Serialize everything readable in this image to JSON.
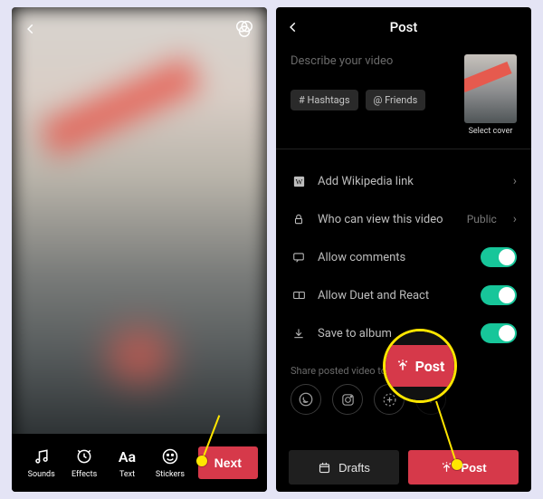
{
  "editor": {
    "tools": {
      "sounds": "Sounds",
      "effects": "Effects",
      "text": "Text",
      "stickers": "Stickers"
    },
    "next_label": "Next"
  },
  "post": {
    "title": "Post",
    "description_placeholder": "Describe your video",
    "chips": {
      "hashtags": "# Hashtags",
      "friends": "@ Friends"
    },
    "cover_label": "Select cover",
    "settings": {
      "wiki": "Add Wikipedia link",
      "privacy": {
        "label": "Who can view this video",
        "value": "Public"
      },
      "comments": "Allow comments",
      "duet": "Allow Duet and React",
      "save": "Save to album"
    },
    "share_label": "Share posted video to:",
    "drafts_label": "Drafts",
    "post_label": "Post",
    "callout_label": "Post"
  }
}
